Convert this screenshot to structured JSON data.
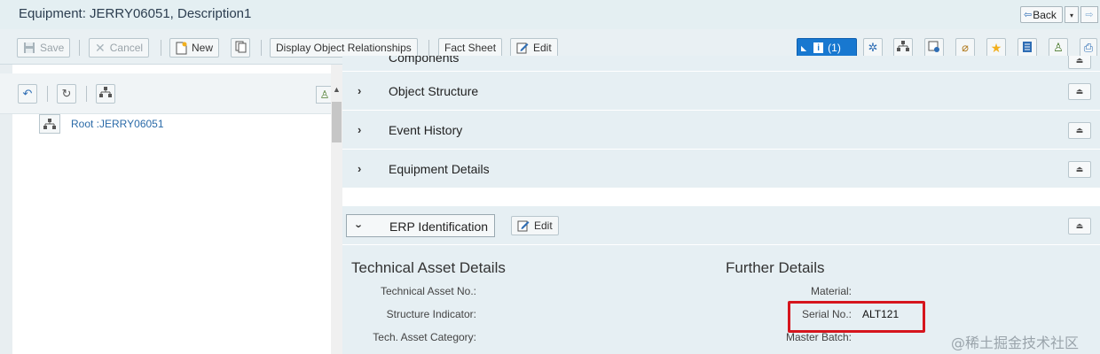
{
  "window": {
    "title": "Equipment: JERRY06051, Description1",
    "back_label": "Back",
    "back_dropdown_glyph": "▾",
    "forward_glyph": "⇨",
    "back_glyph": "⇦"
  },
  "toolbar": {
    "save_label": "Save",
    "cancel_label": "Cancel",
    "new_label": "New",
    "display_relationships_label": "Display Object Relationships",
    "fact_sheet_label": "Fact Sheet",
    "edit_label": "Edit",
    "messages_label": "(1)",
    "accent_color": "#1878d0"
  },
  "left_panel": {
    "tree": {
      "root_label": "Root :JERRY06051"
    },
    "icons": [
      "undo-icon",
      "refresh-icon",
      "hierarchy-icon",
      "user-icon"
    ]
  },
  "sections": [
    {
      "label": "Components",
      "expanded": false
    },
    {
      "label": "Object Structure",
      "expanded": false
    },
    {
      "label": "Event History",
      "expanded": false
    },
    {
      "label": "Equipment Details",
      "expanded": false
    },
    {
      "label": "ERP Identification",
      "expanded": true,
      "edit_label": "Edit"
    }
  ],
  "details": {
    "left_title": "Technical Asset Details",
    "right_title": "Further Details",
    "left_fields": [
      {
        "label": "Technical Asset No.:",
        "value": ""
      },
      {
        "label": "Structure Indicator:",
        "value": ""
      },
      {
        "label": "Tech. Asset Category:",
        "value": ""
      }
    ],
    "right_fields": [
      {
        "label": "Material:",
        "value": ""
      },
      {
        "label": "Serial No.:",
        "value": "ALT121"
      },
      {
        "label": "Master Batch:",
        "value": ""
      }
    ],
    "highlight_color": "#d6151d"
  },
  "watermark": "@稀土掘金技术社区"
}
